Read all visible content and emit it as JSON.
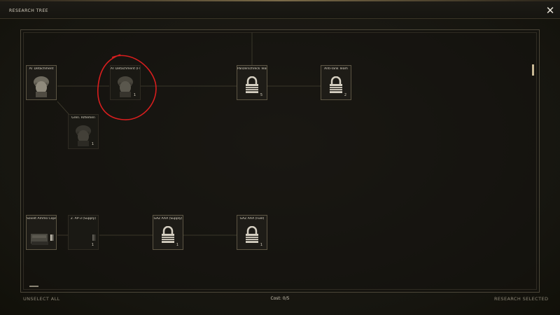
{
  "header": {
    "title": "RESEARCH TREE",
    "close_glyph": "✕"
  },
  "nodes": [
    {
      "label": "AT Detachment",
      "cost": "",
      "icon": "soldier-portrait-icon",
      "state": "unlocked"
    },
    {
      "label": "AT Detachment (FTK",
      "cost": "1",
      "icon": "soldier-portrait-icon",
      "state": "available",
      "highlighted": true
    },
    {
      "label": "Panzerschreck Team",
      "cost": "5",
      "icon": "lock-icon",
      "state": "locked"
    },
    {
      "label": "Anti-Tank Team",
      "cost": "2",
      "icon": "lock-icon",
      "state": "locked"
    },
    {
      "label": "Gren. Riflemen",
      "cost": "1",
      "icon": "soldier-portrait-icon",
      "state": "available"
    },
    {
      "label": "Soviet Ammo Cope",
      "cost": "",
      "icon": "vehicle-icon",
      "state": "unlocked"
    },
    {
      "label": "2. AP-3 (Supply)",
      "cost": "1",
      "icon": "",
      "state": "available"
    },
    {
      "label": "GAZ AAA (Supply)",
      "cost": "1",
      "icon": "lock-icon",
      "state": "locked"
    },
    {
      "label": "GAZ AAA (Fuel)",
      "cost": "1",
      "icon": "lock-icon",
      "state": "locked"
    }
  ],
  "footer": {
    "unselect_all": "UNSELECT ALL",
    "cost_label": "Cost: 0/5",
    "research_selected": "RESEARCH SELECTED"
  },
  "colors": {
    "background": "#191814",
    "node_border": "#5d5644",
    "highlight_circle": "#d81e1e",
    "accent_gold": "#c8b894"
  }
}
